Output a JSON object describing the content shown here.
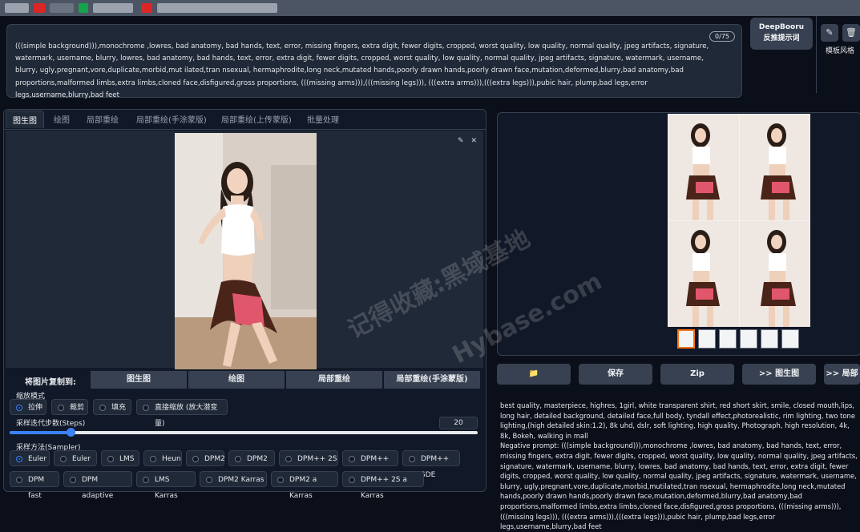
{
  "negative_prompt": {
    "counter": "0/75",
    "text": "(((simple background))),monochrome ,lowres, bad anatomy, bad hands, text, error, missing fingers, extra digit, fewer digits, cropped, worst quality, low quality, normal quality, jpeg artifacts, signature, watermark, username, blurry, lowres, bad anatomy, bad hands, text, error, extra digit, fewer digits, cropped, worst quality, low quality, normal quality, jpeg artifacts, signature, watermark, username, blurry, ugly,pregnant,vore,duplicate,morbid,mut ilated,tran nsexual, hermaphrodite,long neck,mutated hands,poorly drawn hands,poorly drawn face,mutation,deformed,blurry,bad anatomy,bad proportions,malformed limbs,extra limbs,cloned face,disfigured,gross proportions, (((missing arms))),(((missing legs))), (((extra arms))),(((extra legs))),pubic hair, plump,bad legs,error legs,username,blurry,bad feet"
  },
  "deepbooru": {
    "line1": "DeepBooru",
    "line2": "反推提示词"
  },
  "style_label": "模板风格",
  "tabs": [
    "图生图",
    "绘图",
    "局部重绘",
    "局部重绘(手涂蒙版)",
    "局部重绘(上传蒙版)",
    "批量处理"
  ],
  "copy": {
    "label": "将图片复制到:",
    "buttons": [
      "图生图",
      "绘图",
      "局部重绘",
      "局部重绘(手涂蒙版)"
    ]
  },
  "resize": {
    "label": "缩放模式",
    "options": [
      "拉伸",
      "裁剪",
      "填充",
      "直接缩放 (放大潜变量)"
    ],
    "selected": "拉伸"
  },
  "steps": {
    "label": "采样迭代步数(Steps)",
    "value": "20",
    "fraction": 0.13
  },
  "sampler": {
    "label": "采样方法(Sampler)",
    "row1": [
      "Euler a",
      "Euler",
      "LMS",
      "Heun",
      "DPM2",
      "DPM2 a",
      "DPM++ 2S a",
      "DPM++ 2M",
      "DPM++ SDE"
    ],
    "row2": [
      "DPM fast",
      "DPM adaptive",
      "LMS Karras",
      "DPM2 Karras",
      "DPM2 a Karras",
      "DPM++ 2S a Karras"
    ],
    "selected": "Euler a"
  },
  "actions": [
    "📁",
    "保存",
    "Zip",
    ">> 图生图",
    ">> 局部"
  ],
  "info": {
    "prompt": "best quality, masterpiece, highres, 1girl, white transparent shirt, red short skirt, smile, closed mouth,lips, long hair, detailed background, detailed face,full body, tyndall effect,photorealistic, rim lighting, two tone lighting,(high detailed skin:1.2), 8k uhd, dslr, soft lighting, high quality, Photograph, high resolution, 4k, 8k, Bokeh, walking in mall",
    "negative": "Negative prompt: (((simple background))),monochrome ,lowres, bad anatomy, bad hands, text, error, missing fingers, extra digit, fewer digits, cropped, worst quality, low quality, normal quality, jpeg artifacts, signature, watermark, username, blurry, lowres, bad anatomy, bad hands, text, error, extra digit, fewer digits, cropped, worst quality, low quality, normal quality, jpeg artifacts, signature, watermark, username, blurry, ugly,pregnant,vore,duplicate,morbid,mutilated,tran nsexual, hermaphrodite,long neck,mutated hands,poorly drawn hands,poorly drawn face,mutation,deformed,blurry,bad anatomy,bad proportions,malformed limbs,extra limbs,cloned face,disfigured,gross proportions, (((missing arms))),(((missing legs))), (((extra arms))),(((extra legs))),pubic hair, plump,bad legs,error legs,username,blurry,bad feet"
  },
  "watermark": {
    "line1": "记得收藏:黑域基地",
    "line2": "Hybase.com"
  }
}
